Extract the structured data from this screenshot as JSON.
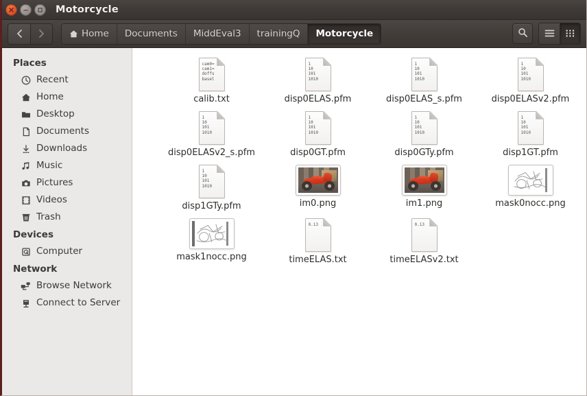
{
  "window": {
    "title": "Motorcycle",
    "buttons": {
      "close": "close-button",
      "minimize": "minimize-button",
      "maximize": "maximize-button"
    }
  },
  "toolbar": {
    "back_label": "‹",
    "forward_label": "›",
    "search_icon": "search-icon",
    "list_view_icon": "list-view-icon",
    "grid_view_icon": "grid-view-icon",
    "active_view": "grid",
    "breadcrumb": [
      {
        "label": "Home",
        "icon": "home-icon",
        "active": false
      },
      {
        "label": "Documents",
        "icon": "",
        "active": false
      },
      {
        "label": "MiddEval3",
        "icon": "",
        "active": false
      },
      {
        "label": "trainingQ",
        "icon": "",
        "active": false
      },
      {
        "label": "Motorcycle",
        "icon": "",
        "active": true
      }
    ]
  },
  "sidebar": {
    "sections": [
      {
        "title": "Places",
        "items": [
          {
            "label": "Recent",
            "icon": "clock-icon"
          },
          {
            "label": "Home",
            "icon": "home-icon"
          },
          {
            "label": "Desktop",
            "icon": "folder-icon"
          },
          {
            "label": "Documents",
            "icon": "document-icon"
          },
          {
            "label": "Downloads",
            "icon": "download-arrow-icon"
          },
          {
            "label": "Music",
            "icon": "music-note-icon"
          },
          {
            "label": "Pictures",
            "icon": "camera-icon"
          },
          {
            "label": "Videos",
            "icon": "film-icon"
          },
          {
            "label": "Trash",
            "icon": "trash-icon"
          }
        ]
      },
      {
        "title": "Devices",
        "items": [
          {
            "label": "Computer",
            "icon": "computer-disk-icon"
          }
        ]
      },
      {
        "title": "Network",
        "items": [
          {
            "label": "Browse Network",
            "icon": "network-icon"
          },
          {
            "label": "Connect to Server",
            "icon": "server-icon"
          }
        ]
      }
    ]
  },
  "files": [
    {
      "name": "calib.txt",
      "icon": "text-document-icon",
      "preview": [
        "cam0=",
        "cam1=",
        "doffs",
        "basel"
      ]
    },
    {
      "name": "disp0ELAS.pfm",
      "icon": "text-document-icon",
      "preview": [
        "1",
        "10",
        "101",
        "1010"
      ]
    },
    {
      "name": "disp0ELAS_s.pfm",
      "icon": "text-document-icon",
      "preview": [
        "1",
        "10",
        "101",
        "1010"
      ]
    },
    {
      "name": "disp0ELASv2.pfm",
      "icon": "text-document-icon",
      "preview": [
        "1",
        "10",
        "101",
        "1010"
      ]
    },
    {
      "name": "disp0ELASv2_s.pfm",
      "icon": "text-document-icon",
      "preview": [
        "1",
        "10",
        "101",
        "1010"
      ]
    },
    {
      "name": "disp0GT.pfm",
      "icon": "text-document-icon",
      "preview": [
        "1",
        "10",
        "101",
        "1010"
      ]
    },
    {
      "name": "disp0GTy.pfm",
      "icon": "text-document-icon",
      "preview": [
        "1",
        "10",
        "101",
        "1010"
      ]
    },
    {
      "name": "disp1GT.pfm",
      "icon": "text-document-icon",
      "preview": [
        "1",
        "10",
        "101",
        "1010"
      ]
    },
    {
      "name": "disp1GTy.pfm",
      "icon": "text-document-icon",
      "preview": [
        "1",
        "10",
        "101",
        "1010"
      ]
    },
    {
      "name": "im0.png",
      "icon": "photo-thumbnail",
      "preview": []
    },
    {
      "name": "im1.png",
      "icon": "photo-thumbnail",
      "preview": []
    },
    {
      "name": "mask0nocc.png",
      "icon": "mask-thumbnail",
      "preview": []
    },
    {
      "name": "mask1nocc.png",
      "icon": "mask-thumbnail",
      "preview": []
    },
    {
      "name": "timeELAS.txt",
      "icon": "text-document-icon",
      "preview": [
        "0.13"
      ]
    },
    {
      "name": "timeELASv2.txt",
      "icon": "text-document-icon",
      "preview": [
        "0.13"
      ]
    }
  ],
  "colors": {
    "titlebar": "#3f3937",
    "toolbar": "#423c39",
    "sidebar_bg": "#ebe9e7",
    "content_bg": "#ffffff",
    "window_border": "#5c1f20",
    "close_button": "#d9502a",
    "text_dark": "#3c3b39",
    "text_light": "#d8d3cf"
  }
}
